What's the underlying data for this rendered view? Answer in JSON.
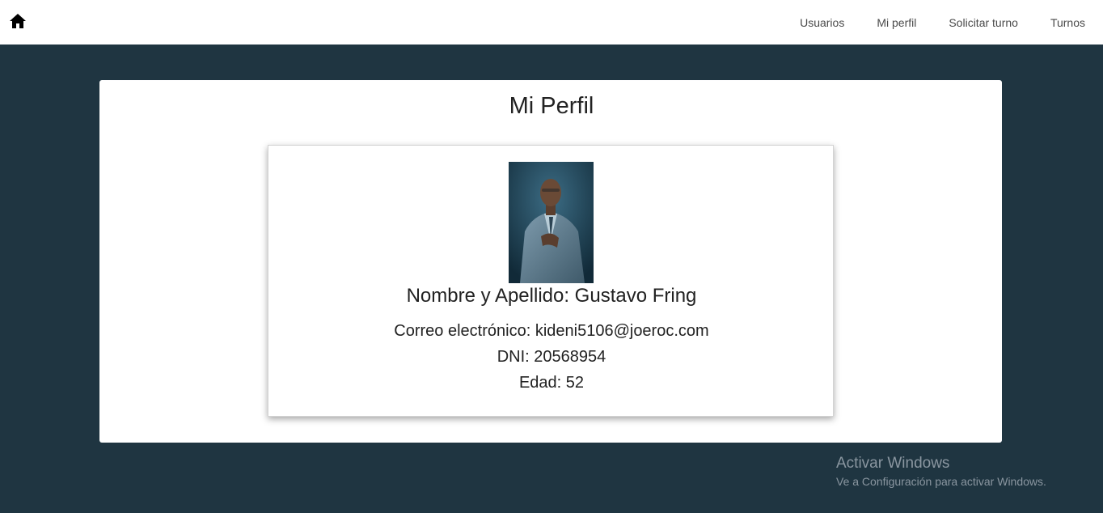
{
  "navbar": {
    "home_icon": "home-icon",
    "links": [
      {
        "label": "Usuarios"
      },
      {
        "label": "Mi perfil"
      },
      {
        "label": "Solicitar turno"
      },
      {
        "label": "Turnos"
      }
    ]
  },
  "page": {
    "title": "Mi Perfil"
  },
  "profile": {
    "name_line": "Nombre y Apellido: Gustavo Fring",
    "email_line": "Correo electrónico: kideni5106@joeroc.com",
    "dni_line": "DNI: 20568954",
    "age_line": "Edad: 52"
  },
  "watermark": {
    "title": "Activar Windows",
    "subtitle": "Ve a Configuración para activar Windows."
  },
  "colors": {
    "background": "#1f3541",
    "card": "#ffffff",
    "text": "#222222"
  }
}
